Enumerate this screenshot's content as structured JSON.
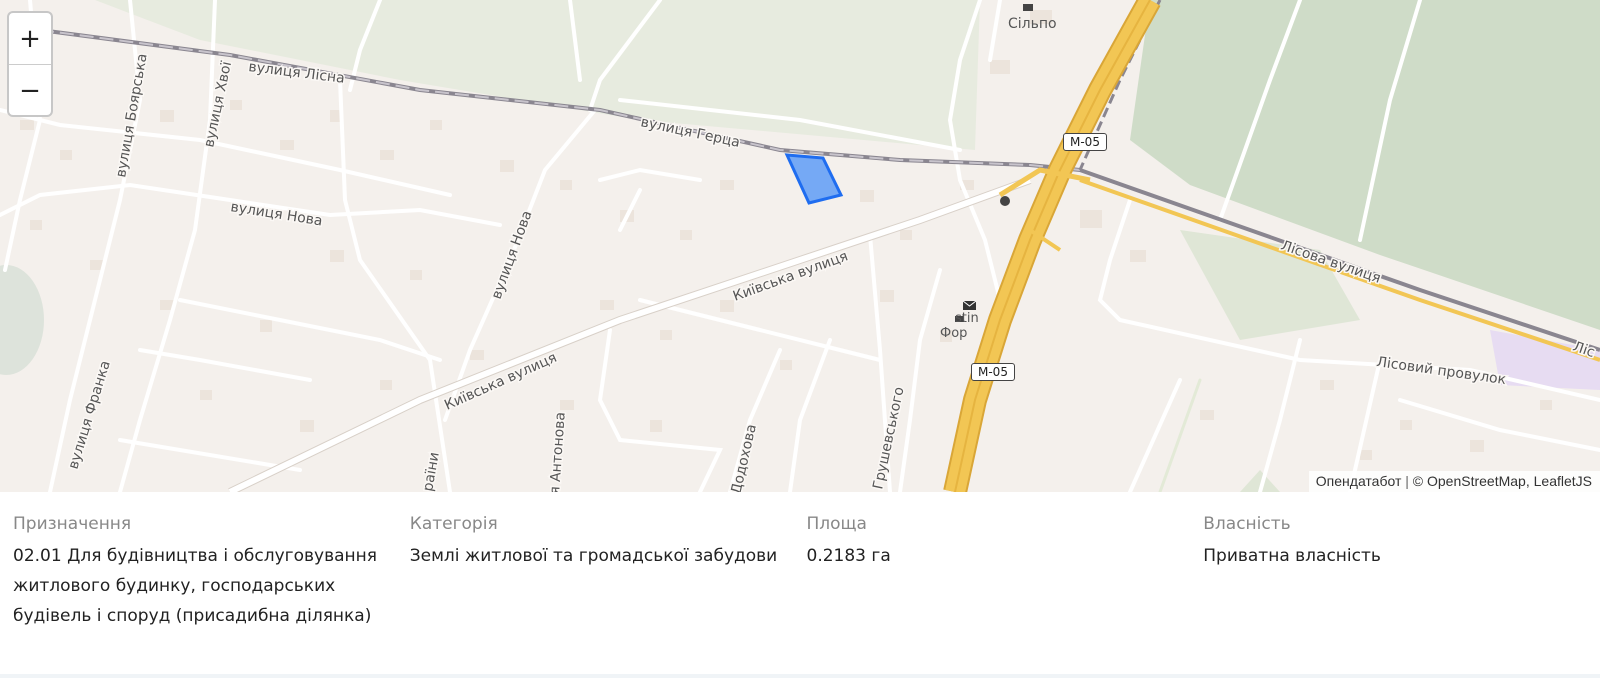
{
  "map": {
    "zoom_in_label": "+",
    "zoom_out_label": "−",
    "attribution": {
      "source": "Опендатабот",
      "separator": "|",
      "osm": "© OpenStreetMap",
      "leaflet": "LeafletJS"
    },
    "labels": {
      "lisna": "вулиця Лісна",
      "hertsa": "вулиця Герца",
      "boiarska": "вулиця Боярська",
      "khvoi": "вулиця Хвої",
      "nova_h": "вулиця Нова",
      "nova_v": "вулиця Нова",
      "kyivska_1": "Київська вулиця",
      "kyivska_2": "Київська вулиця",
      "franka": "вулиця Франка",
      "ukrainy": "раїни",
      "antonova": "я Антонова",
      "dodokhova": "Додохова",
      "hrushevskoho": "Грушевського",
      "lisova": "Лісова вулиця",
      "lisovyi_provulok": "Лісовий провулок",
      "lis_edge": "Ліс"
    },
    "pois": {
      "silpo": "Сільпо",
      "fora_partial": "Фор",
      "postal_partial": "stin"
    },
    "shields": [
      "M-05",
      "M-05"
    ],
    "colors": {
      "parcel_fill": "#5e9cf7",
      "parcel_stroke": "#1f6df0",
      "motorway": "#f2c654",
      "forest": "#e6ebde",
      "field": "#cfdcc8"
    }
  },
  "parcel": {
    "purpose": {
      "label": "Призначення",
      "value": "02.01 Для будівництва і обслуговування житлового будинку, господарських будівель і споруд (присадибна ділянка)"
    },
    "category": {
      "label": "Категорія",
      "value": "Землі житлової та громадської забудови"
    },
    "area": {
      "label": "Площа",
      "value": "0.2183 га"
    },
    "ownership": {
      "label": "Власність",
      "value": "Приватна власність"
    }
  }
}
